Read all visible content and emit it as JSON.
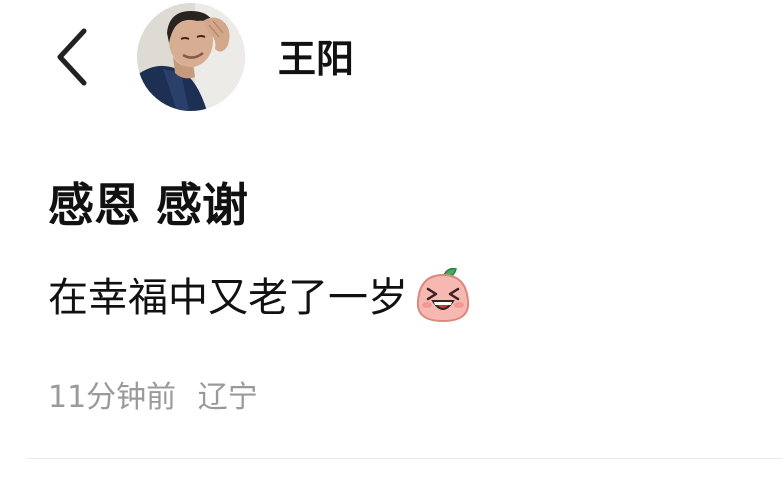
{
  "header": {
    "username": "王阳",
    "back_icon": "chevron-left-icon",
    "avatar_icon": "profile-photo"
  },
  "post": {
    "title": "感恩 感谢",
    "body": "在幸福中又老了一岁",
    "emoji": "laughing-face-emoji",
    "time": "11分钟前",
    "location": "辽宁"
  },
  "colors": {
    "text": "#111111",
    "meta": "#9a9a9a",
    "divider": "#ececec"
  }
}
